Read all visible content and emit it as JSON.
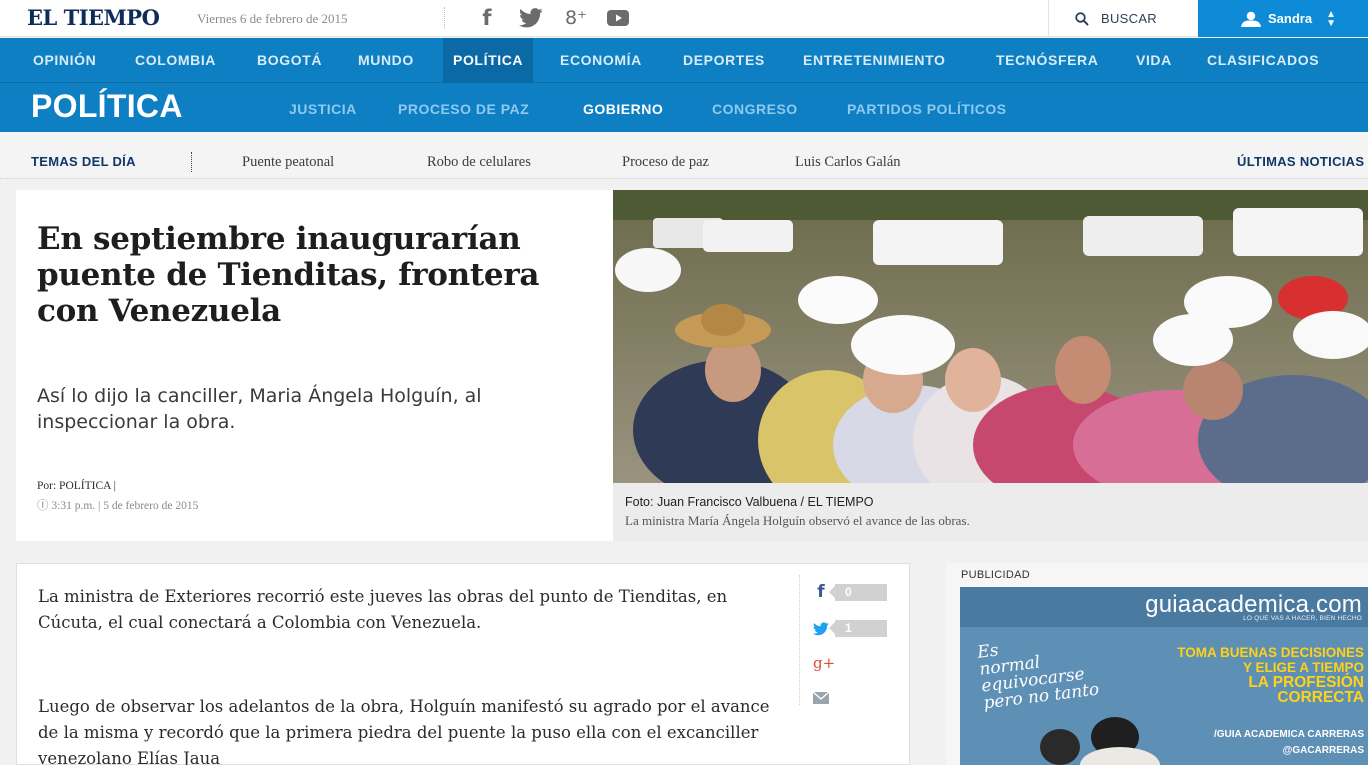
{
  "header": {
    "logo": "EL TIEMPO",
    "date": "Viernes 6 de febrero de 2015",
    "search_label": "BUSCAR",
    "user_name": "Sandra",
    "social_icons": [
      "facebook-icon",
      "twitter-icon",
      "google-plus-icon",
      "youtube-icon"
    ],
    "gplus_glyph": "8⁺"
  },
  "nav": {
    "items": [
      "OPINIÓN",
      "COLOMBIA",
      "BOGOTÁ",
      "MUNDO",
      "POLÍTICA",
      "ECONOMÍA",
      "DEPORTES",
      "ENTRETENIMIENTO",
      "TECNÓSFERA",
      "VIDA",
      "CLASIFICADOS"
    ],
    "active": "POLÍTICA"
  },
  "section": {
    "title": "POLÍTICA",
    "subitems": [
      "JUSTICIA",
      "PROCESO DE PAZ",
      "GOBIERNO",
      "CONGRESO",
      "PARTIDOS POLÍTICOS"
    ],
    "active": "GOBIERNO"
  },
  "temas": {
    "label": "TEMAS DEL DÍA",
    "topics": [
      "Puente peatonal",
      "Robo de celulares",
      "Proceso de paz",
      "Luis Carlos Galán"
    ],
    "ultimas": "ÚLTIMAS NOTICIAS"
  },
  "article": {
    "headline": "En septiembre inaugurarían puente de Tienditas, frontera con Venezuela",
    "dek": "Así lo dijo la canciller, Maria Ángela Holguín, al inspeccionar la obra.",
    "byline": "Por: POLÍTICA |",
    "time": "Ⓘ 3:31 p.m. | 5 de febrero de 2015",
    "photo_credit": "Foto: Juan Francisco Valbuena / EL TIEMPO",
    "photo_caption": "La ministra María Ángela Holguín observó el avance de las obras.",
    "paragraph1": "La ministra de Exteriores recorrió este jueves las obras del punto de Tienditas, en Cúcuta, el cual conectará a Colombia con Venezuela.",
    "paragraph2": "Luego de observar los adelantos de la obra, Holguín manifestó su agrado por el avance de la misma y recordó que la primera piedra del puente la puso ella con el excanciller venezolano Elías Jaua",
    "share": {
      "facebook_count": "0",
      "twitter_count": "1",
      "gplus": "g+",
      "email_icon": "envelope-icon"
    }
  },
  "ad": {
    "label": "PUBLICIDAD",
    "brand": "guiaacademica.com",
    "tagline": "LO QUE VAS A HACER, BIEN HECHO",
    "script_line1": "Es",
    "script_line2": "normal",
    "script_line3": "equivocarse",
    "script_line4": "pero no tanto",
    "cta_line1": "TOMA BUENAS DECISIONES",
    "cta_line2": "Y ELIGE A TIEMPO",
    "cta_line3": "LA PROFESIÓN CORRECTA",
    "social1": "/GUIA ACADEMICA CARRERAS",
    "social2": "@GACARRERAS"
  },
  "colors": {
    "nav_blue": "#0f7fc3",
    "nav_active": "#0b6aa6",
    "user_blue": "#0d8bd6",
    "logo_navy": "#0e2c5a"
  }
}
